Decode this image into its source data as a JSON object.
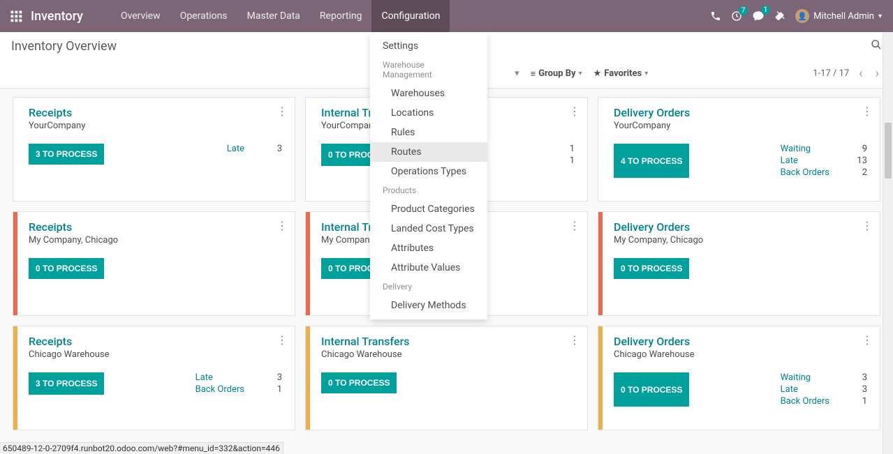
{
  "brand": "Inventory",
  "nav": {
    "items": [
      "Overview",
      "Operations",
      "Master Data",
      "Reporting",
      "Configuration"
    ]
  },
  "systray": {
    "activities_count": "7",
    "messages_count": "1",
    "user_name": "Mitchell Admin"
  },
  "page_title": "Inventory Overview",
  "dropdown": {
    "settings": "Settings",
    "warehouse_header": "Warehouse Management",
    "warehouses": "Warehouses",
    "locations": "Locations",
    "rules": "Rules",
    "routes": "Routes",
    "op_types": "Operations Types",
    "products_header": "Products",
    "product_categories": "Product Categories",
    "landed_cost": "Landed Cost Types",
    "attributes": "Attributes",
    "attribute_values": "Attribute Values",
    "delivery_header": "Delivery",
    "delivery_methods": "Delivery Methods"
  },
  "toolbar": {
    "groupby": "Group By",
    "favorites": "Favorites",
    "pager": "1-17 / 17"
  },
  "cards": [
    {
      "title": "Receipts",
      "sub": "YourCompany",
      "process": "3 TO PROCESS",
      "color": "",
      "stats": [
        {
          "label": "Late",
          "value": "3"
        }
      ]
    },
    {
      "title": "Internal Transfers",
      "sub": "YourCompany",
      "process": "0 TO PROCESS",
      "color": "",
      "stats": [
        {
          "label": "",
          "value": "1"
        },
        {
          "label": "",
          "value": "1"
        }
      ]
    },
    {
      "title": "Delivery Orders",
      "sub": "YourCompany",
      "process": "4 TO PROCESS",
      "color": "",
      "stats": [
        {
          "label": "Waiting",
          "value": "9"
        },
        {
          "label": "Late",
          "value": "13"
        },
        {
          "label": "Back Orders",
          "value": "2"
        }
      ]
    },
    {
      "title": "Receipts",
      "sub": "My Company, Chicago",
      "process": "0 TO PROCESS",
      "color": "#eb6a52",
      "stats": []
    },
    {
      "title": "Internal Transfers",
      "sub": "My Company, Chicago",
      "process": "0 TO PROCESS",
      "color": "#eb6a52",
      "stats": []
    },
    {
      "title": "Delivery Orders",
      "sub": "My Company, Chicago",
      "process": "0 TO PROCESS",
      "color": "#eb6a52",
      "stats": []
    },
    {
      "title": "Receipts",
      "sub": "Chicago Warehouse",
      "process": "3 TO PROCESS",
      "color": "#f0ad4e",
      "stats": [
        {
          "label": "Late",
          "value": "3"
        },
        {
          "label": "Back Orders",
          "value": "1"
        }
      ]
    },
    {
      "title": "Internal Transfers",
      "sub": "Chicago Warehouse",
      "process": "0 TO PROCESS",
      "color": "#f0ad4e",
      "stats": []
    },
    {
      "title": "Delivery Orders",
      "sub": "Chicago Warehouse",
      "process": "0 TO PROCESS",
      "color": "#f0ad4e",
      "stats": [
        {
          "label": "Waiting",
          "value": "3"
        },
        {
          "label": "Late",
          "value": "3"
        },
        {
          "label": "Back Orders",
          "value": "1"
        }
      ]
    }
  ],
  "status_url": "650489-12-0-2709f4.runbot20.odoo.com/web?#menu_id=332&action=446"
}
